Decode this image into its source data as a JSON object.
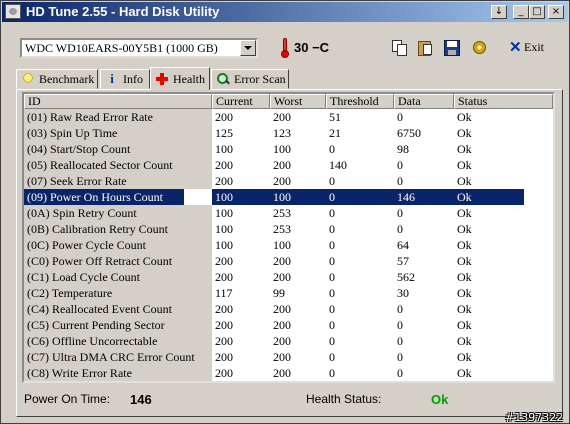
{
  "window": {
    "title": "HD Tune 2.55 - Hard Disk Utility",
    "controls": [
      "↓",
      "_",
      "□",
      "×"
    ]
  },
  "toolbar": {
    "drive": "WDC WD10EARS-00Y5B1 (1000 GB)",
    "temperature": "30 −C",
    "icons": [
      "copy-icon",
      "clipboard-icon",
      "save-icon",
      "options-icon"
    ],
    "exit_label": "Exit"
  },
  "tabs": [
    {
      "label": "Benchmark",
      "icon": "lightbulb-icon"
    },
    {
      "label": "Info",
      "icon": "info-icon"
    },
    {
      "label": "Health",
      "icon": "red-cross-icon",
      "active": true
    },
    {
      "label": "Error Scan",
      "icon": "magnifier-icon"
    }
  ],
  "health": {
    "columns": [
      "ID",
      "Current",
      "Worst",
      "Threshold",
      "Data",
      "Status"
    ],
    "selected_index": 5,
    "rows": [
      {
        "id": "(01) Raw Read Error Rate",
        "current": "200",
        "worst": "200",
        "threshold": "51",
        "data": "0",
        "status": "Ok"
      },
      {
        "id": "(03) Spin Up Time",
        "current": "125",
        "worst": "123",
        "threshold": "21",
        "data": "6750",
        "status": "Ok"
      },
      {
        "id": "(04) Start/Stop Count",
        "current": "100",
        "worst": "100",
        "threshold": "0",
        "data": "98",
        "status": "Ok"
      },
      {
        "id": "(05) Reallocated Sector Count",
        "current": "200",
        "worst": "200",
        "threshold": "140",
        "data": "0",
        "status": "Ok"
      },
      {
        "id": "(07) Seek Error Rate",
        "current": "200",
        "worst": "200",
        "threshold": "0",
        "data": "0",
        "status": "Ok"
      },
      {
        "id": "(09) Power On Hours Count",
        "current": "100",
        "worst": "100",
        "threshold": "0",
        "data": "146",
        "status": "Ok"
      },
      {
        "id": "(0A) Spin Retry Count",
        "current": "100",
        "worst": "253",
        "threshold": "0",
        "data": "0",
        "status": "Ok"
      },
      {
        "id": "(0B) Calibration Retry Count",
        "current": "100",
        "worst": "253",
        "threshold": "0",
        "data": "0",
        "status": "Ok"
      },
      {
        "id": "(0C) Power Cycle Count",
        "current": "100",
        "worst": "100",
        "threshold": "0",
        "data": "64",
        "status": "Ok"
      },
      {
        "id": "(C0) Power Off Retract Count",
        "current": "200",
        "worst": "200",
        "threshold": "0",
        "data": "57",
        "status": "Ok"
      },
      {
        "id": "(C1) Load Cycle Count",
        "current": "200",
        "worst": "200",
        "threshold": "0",
        "data": "562",
        "status": "Ok"
      },
      {
        "id": "(C2) Temperature",
        "current": "117",
        "worst": "99",
        "threshold": "0",
        "data": "30",
        "status": "Ok"
      },
      {
        "id": "(C4) Reallocated Event Count",
        "current": "200",
        "worst": "200",
        "threshold": "0",
        "data": "0",
        "status": "Ok"
      },
      {
        "id": "(C5) Current Pending Sector",
        "current": "200",
        "worst": "200",
        "threshold": "0",
        "data": "0",
        "status": "Ok"
      },
      {
        "id": "(C6) Offline Uncorrectable",
        "current": "200",
        "worst": "200",
        "threshold": "0",
        "data": "0",
        "status": "Ok"
      },
      {
        "id": "(C7) Ultra DMA CRC Error Count",
        "current": "200",
        "worst": "200",
        "threshold": "0",
        "data": "0",
        "status": "Ok"
      },
      {
        "id": "(C8) Write Error Rate",
        "current": "200",
        "worst": "200",
        "threshold": "0",
        "data": "0",
        "status": "Ok"
      }
    ]
  },
  "status": {
    "power_on_label": "Power On Time:",
    "power_on_value": "146",
    "health_label": "Health Status:",
    "health_value": "Ok",
    "health_color": "#00a000"
  },
  "watermark": "#1397322",
  "colors": {
    "titlebar": "#0a246a",
    "selection": "#0a246a",
    "face": "#d4d0c8"
  }
}
